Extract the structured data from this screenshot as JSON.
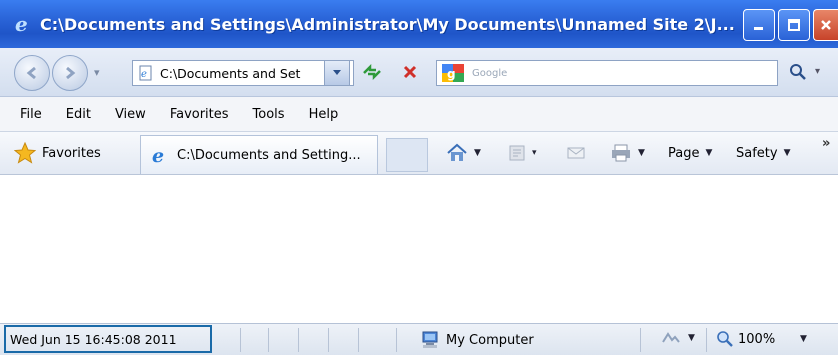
{
  "window": {
    "title": "C:\\Documents and Settings\\Administrator\\My Documents\\Unnamed Site 2\\J..."
  },
  "address_bar": {
    "url": "C:\\Documents and Set"
  },
  "search": {
    "placeholder": "Google"
  },
  "menu": {
    "items": [
      "File",
      "Edit",
      "View",
      "Favorites",
      "Tools",
      "Help"
    ]
  },
  "favorites_bar": {
    "favorites_label": "Favorites",
    "tab_label": "C:\\Documents and Setting...",
    "page_label": "Page",
    "safety_label": "Safety",
    "chevron": "»"
  },
  "status_bar": {
    "datetime": "Wed Jun 15 16:45:08 2011",
    "zone": "My Computer",
    "zoom": "100%"
  },
  "colors": {
    "titlebar": "#2a64d8",
    "close_button": "#c7432a",
    "status_highlight": "#1a6aa8"
  },
  "icons": [
    "ie-logo-icon",
    "minimize-icon",
    "maximize-icon",
    "close-icon",
    "back-arrow-icon",
    "forward-arrow-icon",
    "page-icon",
    "refresh-icon",
    "stop-icon",
    "google-icon",
    "search-icon",
    "star-icon",
    "home-icon",
    "feeds-icon",
    "mail-icon",
    "print-icon",
    "computer-icon",
    "protected-mode-icon",
    "zoom-icon"
  ]
}
